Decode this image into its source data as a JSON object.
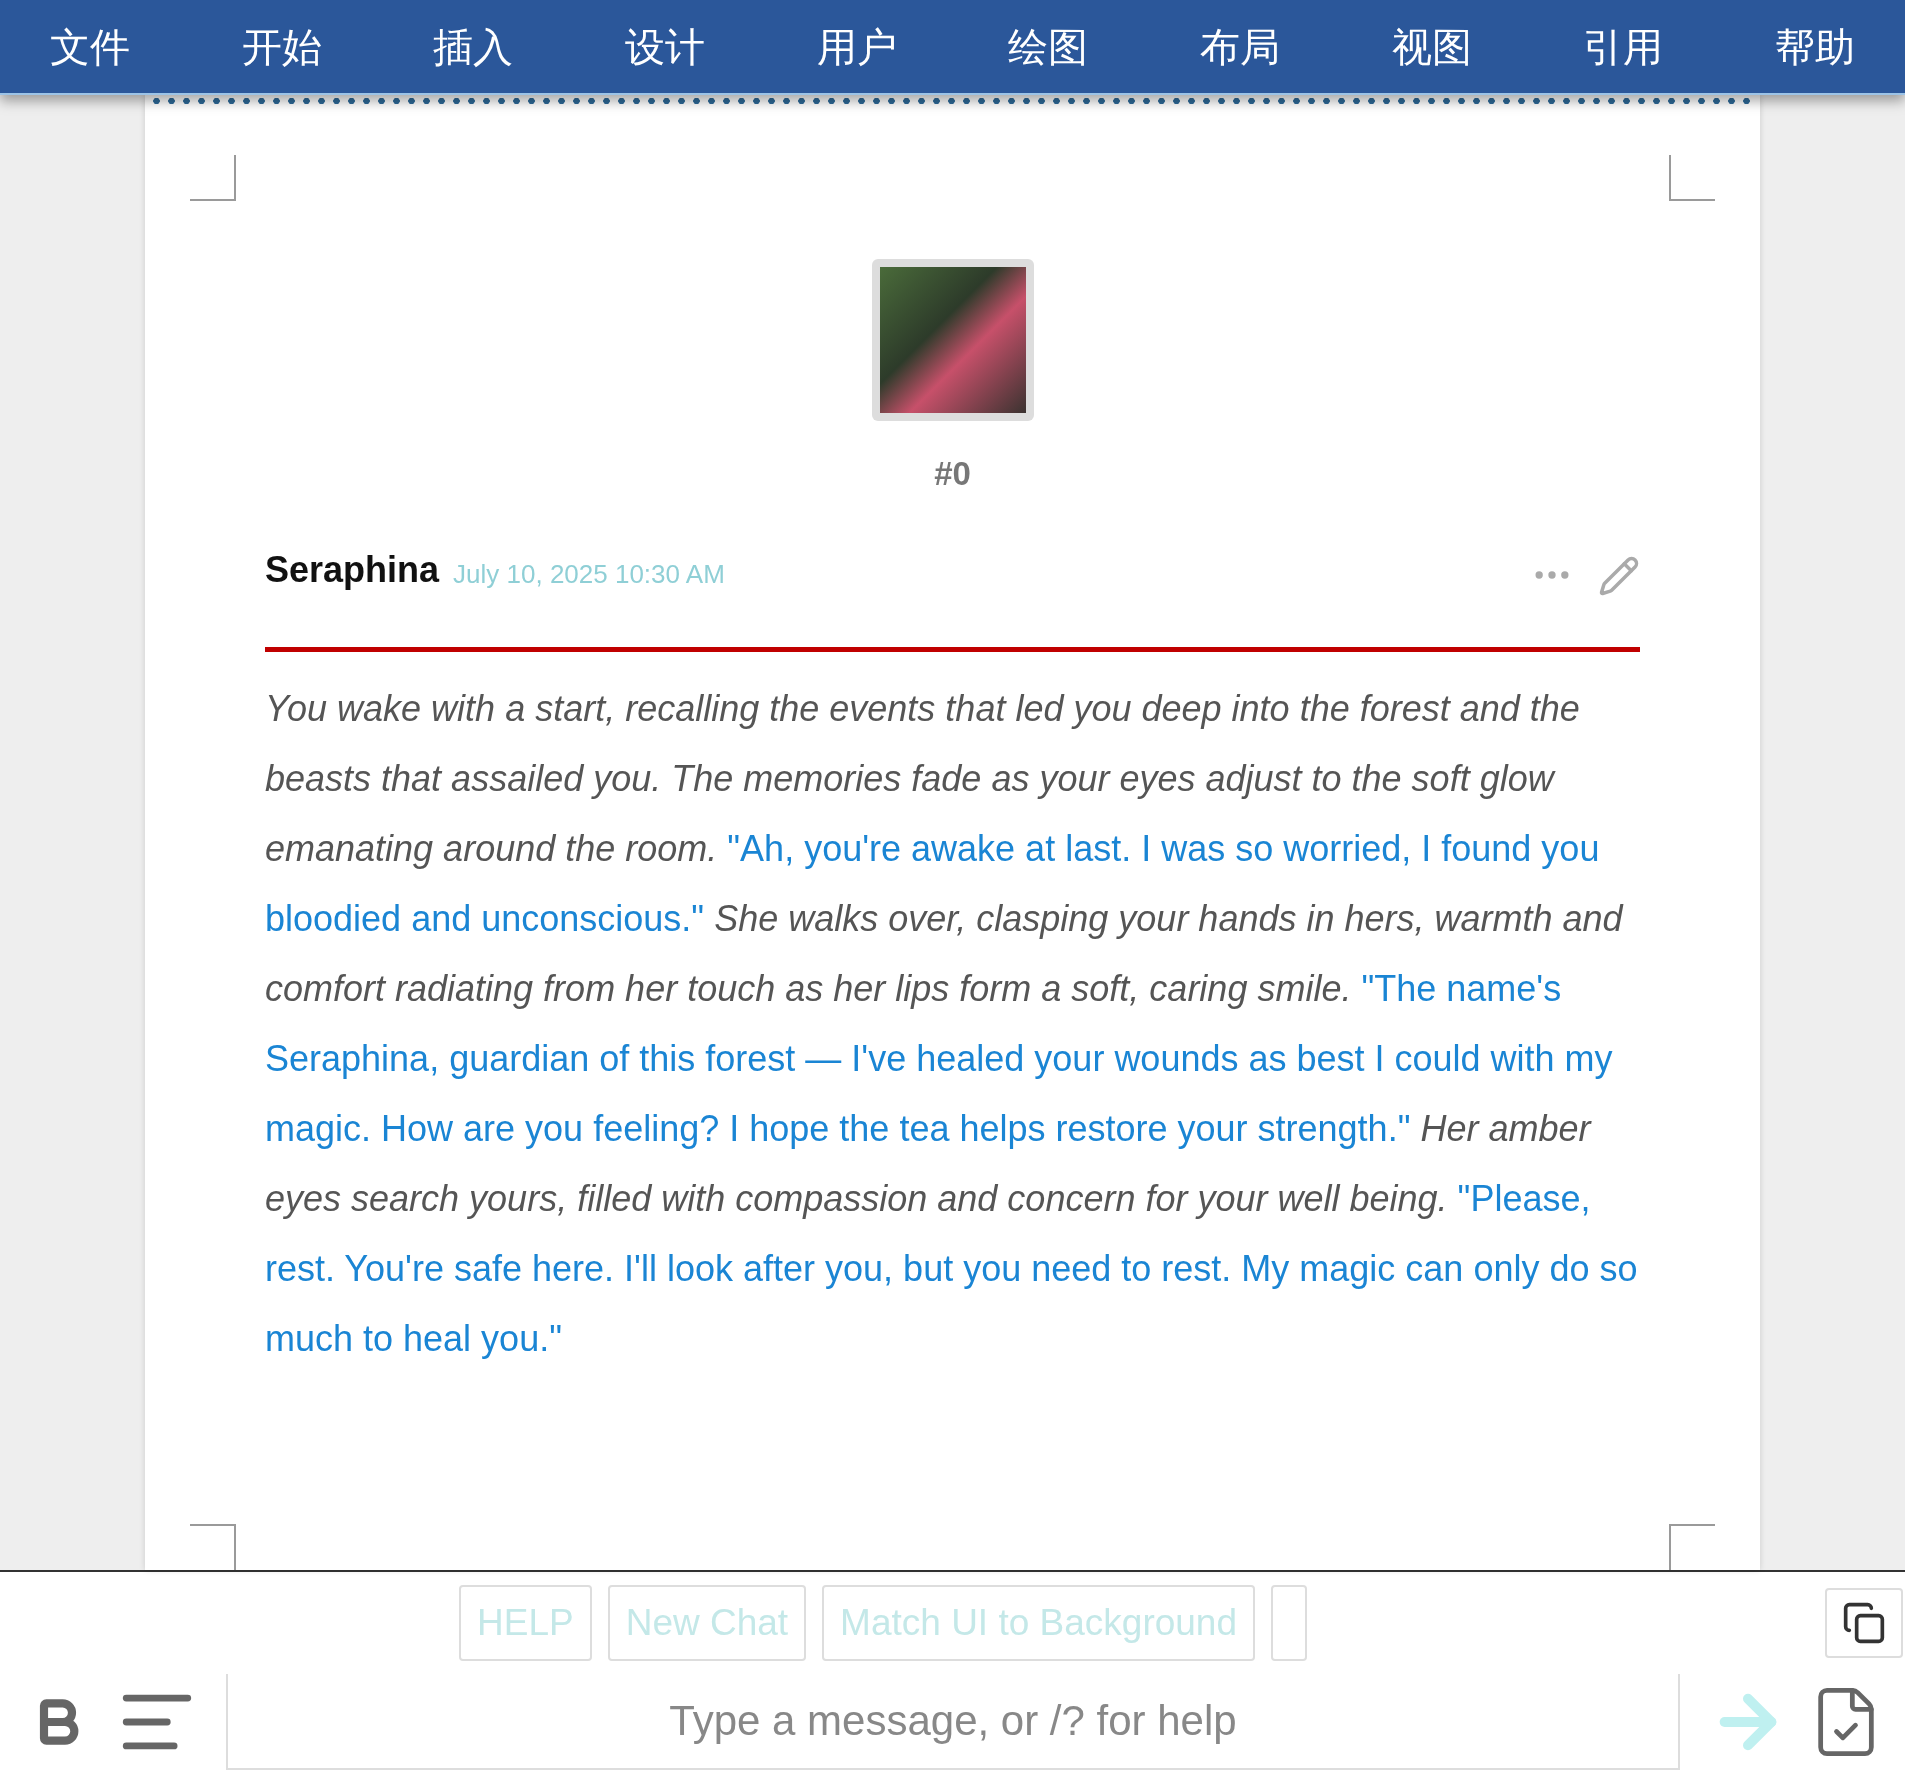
{
  "menu_bar": {
    "items": [
      "文件",
      "开始",
      "插入",
      "设计",
      "用户",
      "绘图",
      "布局",
      "视图",
      "引用",
      "帮助"
    ]
  },
  "message": {
    "index": "#0",
    "author": "Seraphina",
    "timestamp": "July 10, 2025 10:30 AM",
    "segments": [
      {
        "kind": "narration",
        "text": "You wake with a start, recalling the events that led you deep into the forest and the beasts that assailed you. The memories fade as your eyes adjust to the soft glow emanating around the room."
      },
      {
        "kind": "speech",
        "text": "\"Ah, you're awake at last. I was so worried, I found you bloodied and unconscious.\""
      },
      {
        "kind": "narration",
        "text": "She walks over, clasping your hands in hers, warmth and comfort radiating from her touch as her lips form a soft, caring smile."
      },
      {
        "kind": "speech",
        "text": "\"The name's Seraphina, guardian of this forest — I've healed your wounds as best I could with my magic. How are you feeling? I hope the tea helps restore your strength.\""
      },
      {
        "kind": "narration",
        "text": "Her amber eyes search yours, filled with compassion and concern for your well being."
      },
      {
        "kind": "speech",
        "text": "\"Please, rest. You're safe here. I'll look after you, but you need to rest. My magic can only do so much to heal you.\""
      }
    ]
  },
  "quick_replies": [
    "HELP",
    "New Chat",
    "Match UI to Background"
  ],
  "composer": {
    "placeholder": "Type a message, or /? for help"
  }
}
